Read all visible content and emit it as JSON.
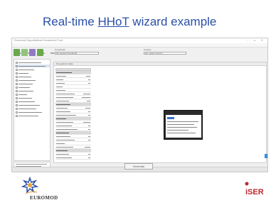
{
  "slide": {
    "title_prefix": "Real-time ",
    "title_link": "HHoT",
    "title_suffix": " wizard example"
  },
  "window": {
    "title": "Euromod Hypothetical Household Tool",
    "controls": "–  ▫  ×"
  },
  "menu": [
    "Project",
    "View",
    "Tools",
    "Advanced Options",
    "Window",
    "Help"
  ],
  "toolbar": {
    "colors": [
      "#6aa84f",
      "#93c47d",
      "#8e7cc3",
      "#6aa84f"
    ]
  },
  "top_fields": {
    "household_label": "Household",
    "household_value": "My sample household",
    "country_label": "Country",
    "country_value": "EU: select country"
  },
  "content": {
    "header_label": "Household data"
  },
  "next_button": "Generate",
  "footer": {
    "euromod": "EUROMOD",
    "iser": "iSER"
  },
  "colors": {
    "title": "#2a4fa8",
    "accent_blue": "#3a8fd6",
    "iser_red": "#c0272d",
    "euromod_orange": "#e8a23a"
  },
  "icons": [
    "euromod-logo-icon",
    "iser-logo-icon"
  ]
}
